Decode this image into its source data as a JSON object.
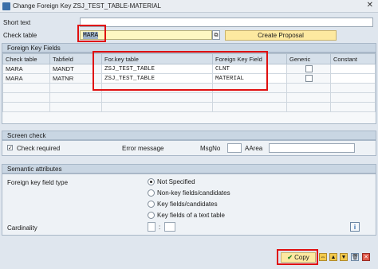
{
  "window": {
    "title": "Change Foreign Key ZSJ_TEST_TABLE-MATERIAL"
  },
  "header": {
    "short_text_label": "Short text",
    "short_text_value": "",
    "check_table_label": "Check table",
    "check_table_value": "MARA",
    "create_proposal_label": "Create Proposal"
  },
  "fk_fields": {
    "title": "Foreign Key Fields",
    "columns": [
      "Check table",
      "Tabfield",
      "For.key table",
      "Foreign Key Field",
      "Generic",
      "Constant"
    ],
    "rows": [
      {
        "check_table": "MARA",
        "tabfield": "MANDT",
        "fk_table": "ZSJ_TEST_TABLE",
        "fk_field": "CLNT"
      },
      {
        "check_table": "MARA",
        "tabfield": "MATNR",
        "fk_table": "ZSJ_TEST_TABLE",
        "fk_field": "MATERIAL"
      }
    ]
  },
  "screen_check": {
    "title": "Screen check",
    "check_required_label": "Check required",
    "error_message_label": "Error message",
    "msgno_label": "MsgNo",
    "aarea_label": "AArea"
  },
  "semantic": {
    "title": "Semantic attributes",
    "fk_field_type_label": "Foreign key field type",
    "options": [
      "Not Specified",
      "Non-key fields/candidates",
      "Key fields/candidates",
      "Key fields of a text table"
    ],
    "cardinality_label": "Cardinality",
    "cardinality_sep": ":"
  },
  "footer": {
    "copy_label": "Copy"
  },
  "colors": {
    "highlight": "#e01010",
    "button": "#fde9a0",
    "panel": "#dfe6ee"
  }
}
